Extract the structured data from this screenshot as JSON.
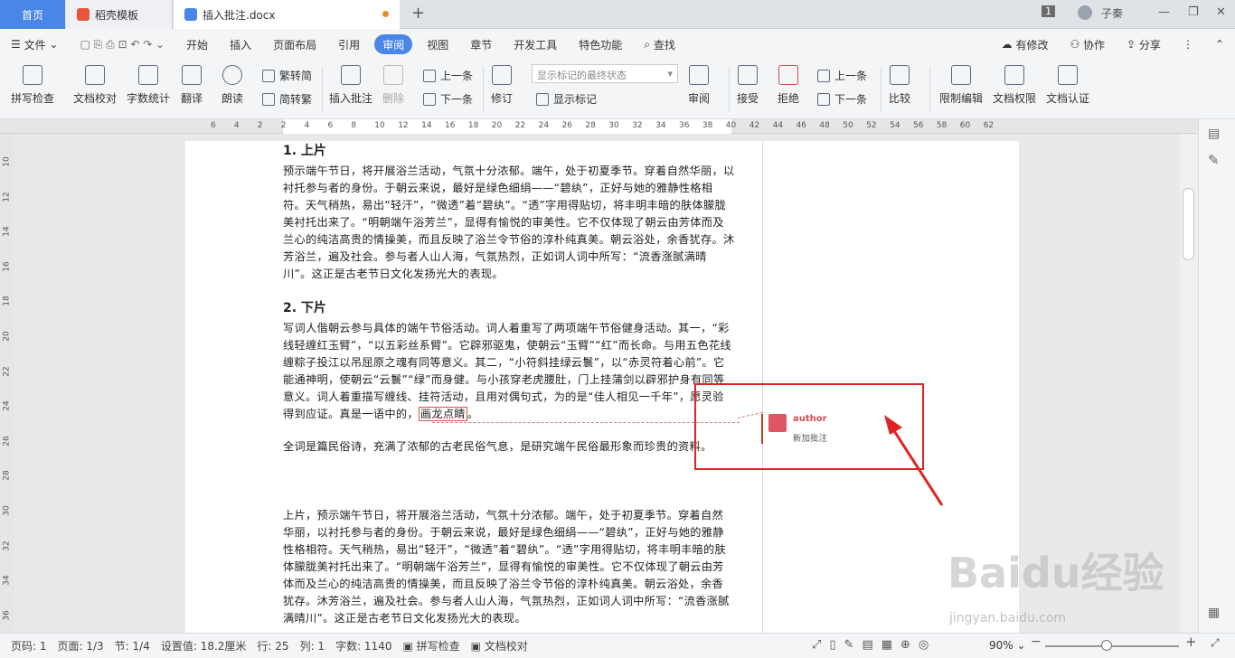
{
  "tabs": {
    "home": "首页",
    "template": "稻壳模板",
    "doc": "插入批注.docx"
  },
  "window": {
    "page_badge": "1",
    "user": "子秦",
    "min": "—",
    "max": "❐",
    "close": "✕"
  },
  "menu": {
    "file": "文件",
    "items": [
      "开始",
      "插入",
      "页面布局",
      "引用",
      "审阅",
      "视图",
      "章节",
      "开发工具",
      "特色功能"
    ],
    "search": "查找",
    "has_changes": "有修改",
    "collab": "协作",
    "share": "分享"
  },
  "toolbar": {
    "spell": "拼写检查",
    "proof": "文档校对",
    "wordcount": "字数统计",
    "translate": "翻译",
    "read": "朗读",
    "to_trad": "繁转简",
    "to_simp": "简转繁",
    "insert_comment": "插入批注",
    "delete": "删除",
    "prev_comment": "上一条",
    "next_comment": "下一条",
    "revise": "修订",
    "markup_select": "显示标记的最终状态",
    "show_markup": "显示标记",
    "review": "审阅",
    "accept": "接受",
    "reject": "拒绝",
    "prev_change": "上一条",
    "next_change": "下一条",
    "compare": "比较",
    "restrict": "限制编辑",
    "rights": "文档权限",
    "cert": "文档认证"
  },
  "ruler": {
    "h": [
      "6",
      "4",
      "2",
      "2",
      "4",
      "6",
      "8",
      "10",
      "12",
      "14",
      "16",
      "18",
      "20",
      "22",
      "24",
      "26",
      "28",
      "30",
      "32",
      "34",
      "36",
      "38",
      "40",
      "42",
      "44",
      "46",
      "48",
      "50",
      "52",
      "54",
      "56",
      "58",
      "60",
      "62"
    ],
    "v": [
      "10",
      "12",
      "14",
      "16",
      "18",
      "20",
      "22",
      "24",
      "26",
      "28",
      "30",
      "32",
      "34",
      "36"
    ]
  },
  "doc": {
    "h1": "1. 上片",
    "p1": "预示端午节日，将开展浴兰活动，气氛十分浓郁。端午，处于初夏季节。穿着自然华丽，以衬托参与者的身份。于朝云来说，最好是绿色细绢——“碧纨”，正好与她的雅静性格相符。天气稍热，易出“轻汗”，“微透”着“碧纨”。“透”字用得贴切，将丰明丰暗的肤体朦胧美衬托出来了。“明朝端午浴芳兰”，显得有愉悦的审美性。它不仅体现了朝云由芳体而及兰心的纯洁高贵的情操美，而且反映了浴兰令节俗的淳朴纯真美。朝云浴处，余香犹存。沐芳浴兰，遍及社会。参与者人山人海，气氛热烈，正如词人词中所写：“流香涨腻满晴川”。这正是古老节日文化发扬光大的表现。",
    "h2": "2. 下片",
    "p2": "写词人偕朝云参与具体的端午节俗活动。词人着重写了两项端午节俗健身活动。其一，“彩线轻缠红玉臂”，“以五彩丝系臂”。它辟邪驱鬼，使朝云“玉臂”“红”而长命。与用五色花线缠粽子投江以吊屈原之魂有同等意义。其二，“小符斜挂绿云鬟”，以“赤灵符着心前”。它能通神明，使朝云“云鬟”“绿”而身健。与小孩穿老虎腰肚，门上挂蒲剑以辟邪护身有同等意义。词人着重描写缠线、挂符活动，且用对偶句式，为的是“佳人相见一千年”，愿灵验得到应证。真是一语中的，",
    "p2_highlight": "画龙点睛",
    "p2_end": "。",
    "p3": "全词是篇民俗诗，充满了浓郁的古老民俗气息，是研究端午民俗最形象而珍贵的资料。",
    "p4": "上片，预示端午节日，将开展浴兰活动，气氛十分浓郁。端午，处于初夏季节。穿着自然华丽，以衬托参与者的身份。于朝云来说，最好是绿色细绢——“碧纨”，正好与她的雅静性格相符。天气稍热，易出“轻汗”，“微透”着“碧纨”。“透”字用得贴切，将丰明丰暗的肤体朦胧美衬托出来了。“明朝端午浴芳兰”，显得有愉悦的审美性。它不仅体现了朝云由芳体而及兰心的纯洁高贵的情操美，而且反映了浴兰令节俗的淳朴纯真美。朝云浴处，余香犹存。沐芳浴兰，遍及社会。参与者人山人海，气氛热烈，正如词人词中所写：“流香涨腻满晴川”。这正是古老节日文化发扬光大的表现。"
  },
  "comment": {
    "author": "author",
    "text": "新加批注"
  },
  "status": {
    "page": "页码: 1",
    "pages": "页面: 1/3",
    "section": "节: 1/4",
    "setting": "设置值: 18.2厘米",
    "row": "行: 25",
    "col": "列: 1",
    "chars": "字数: 1140",
    "spell": "拼写检查",
    "proof": "文档校对",
    "zoom": "90%"
  },
  "watermark": {
    "main": "Baidu经验",
    "url": "jingyan.baidu.com"
  },
  "colors": {
    "accent": "#4a86e8",
    "comment": "#d14b55",
    "highlight_box": "#e02424"
  }
}
